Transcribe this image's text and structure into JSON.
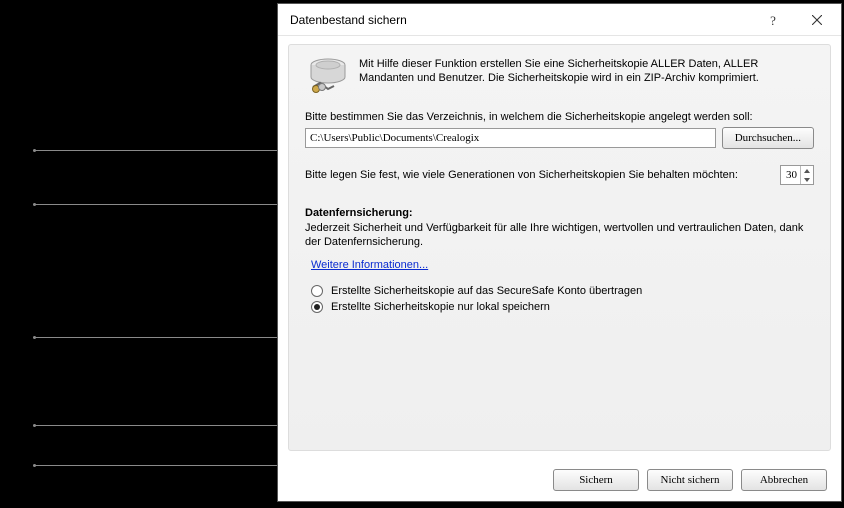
{
  "window": {
    "title": "Datenbestand sichern"
  },
  "intro": "Mit Hilfe dieser Funktion erstellen Sie eine Sicherheitskopie ALLER Daten, ALLER Mandanten und Benutzer. Die Sicherheitskopie wird in ein ZIP-Archiv komprimiert.",
  "dir": {
    "label": "Bitte bestimmen Sie das Verzeichnis, in welchem die Sicherheitskopie angelegt werden soll:",
    "value": "C:\\Users\\Public\\Documents\\Crealogix",
    "browse": "Durchsuchen..."
  },
  "gen": {
    "label": "Bitte legen Sie fest, wie viele Generationen von Sicherheitskopien Sie behalten möchten:",
    "value": "30"
  },
  "remote": {
    "title": "Datenfernsicherung:",
    "desc": "Jederzeit Sicherheit und Verfügbarkeit für alle Ihre wichtigen, wertvollen und vertraulichen Daten, dank der Datenfernsicherung.",
    "link": "Weitere Informationen...",
    "opt_upload": "Erstellte Sicherheitskopie auf das SecureSafe Konto  übertragen",
    "opt_local": "Erstellte Sicherheitskopie nur lokal speichern"
  },
  "buttons": {
    "save": "Sichern",
    "nosave": "Nicht sichern",
    "cancel": "Abbrechen"
  }
}
